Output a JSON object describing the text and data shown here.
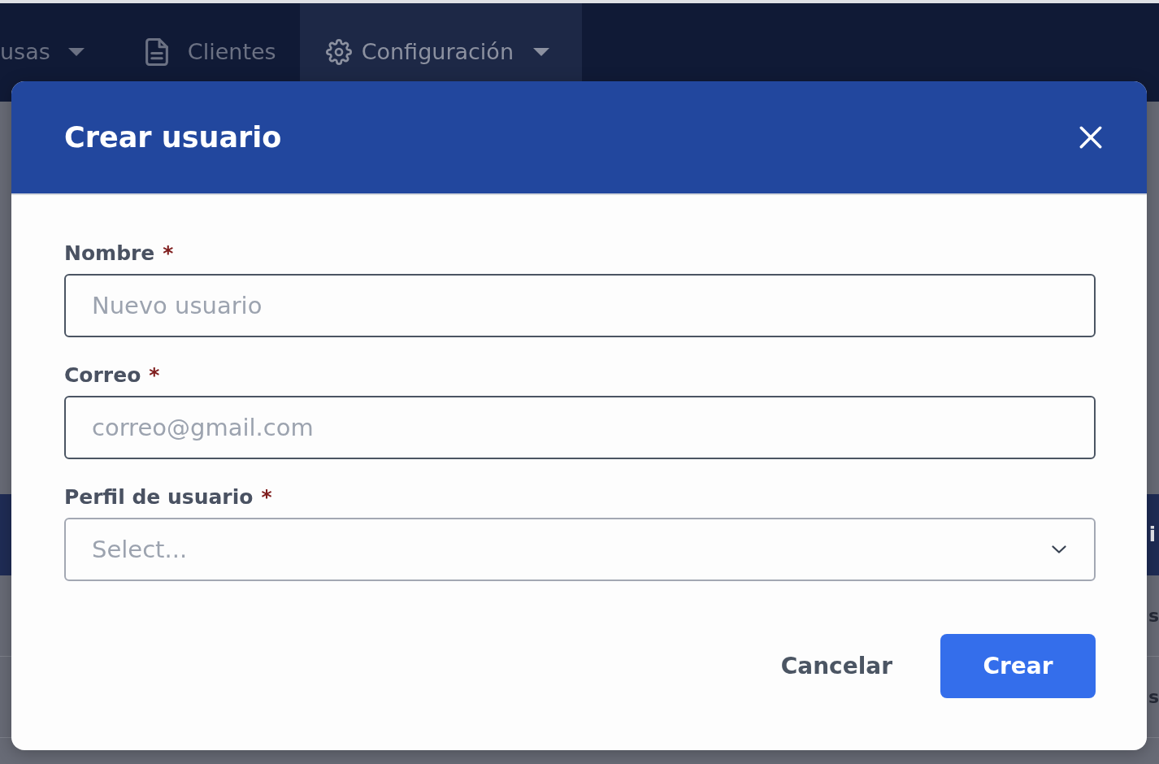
{
  "nav": {
    "items": [
      {
        "label": "usas",
        "dropdown": true,
        "selected": false
      },
      {
        "label": "Clientes",
        "dropdown": false,
        "selected": false
      },
      {
        "label": "Configuración",
        "dropdown": true,
        "selected": true
      }
    ]
  },
  "background": {
    "banner_text": "i",
    "rows": [
      {
        "column_text": "s"
      },
      {
        "column_text": "s"
      }
    ]
  },
  "dialog": {
    "title": "Crear usuario",
    "fields": [
      {
        "kind": "text",
        "label": "Nombre",
        "required_mark": "*",
        "placeholder": "Nuevo usuario"
      },
      {
        "kind": "text",
        "label": "Correo",
        "required_mark": "*",
        "placeholder": "correo@gmail.com"
      },
      {
        "kind": "select",
        "label": "Perfil de usuario",
        "required_mark": "*",
        "placeholder": "Select..."
      }
    ],
    "buttons": [
      {
        "kind": "secondary",
        "label": "Cancelar"
      },
      {
        "kind": "primary",
        "label": "Crear"
      }
    ]
  }
}
